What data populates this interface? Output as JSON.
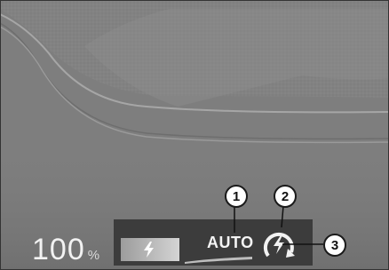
{
  "battery": {
    "value": "100",
    "unit": "%"
  },
  "charge_mode": {
    "label": "AUTO"
  },
  "callouts": [
    "1",
    "2",
    "3"
  ],
  "icons": {
    "battery_gauge": "lightning-bolt-icon",
    "charge_mode": "circular-arrow-lightning-icon"
  }
}
